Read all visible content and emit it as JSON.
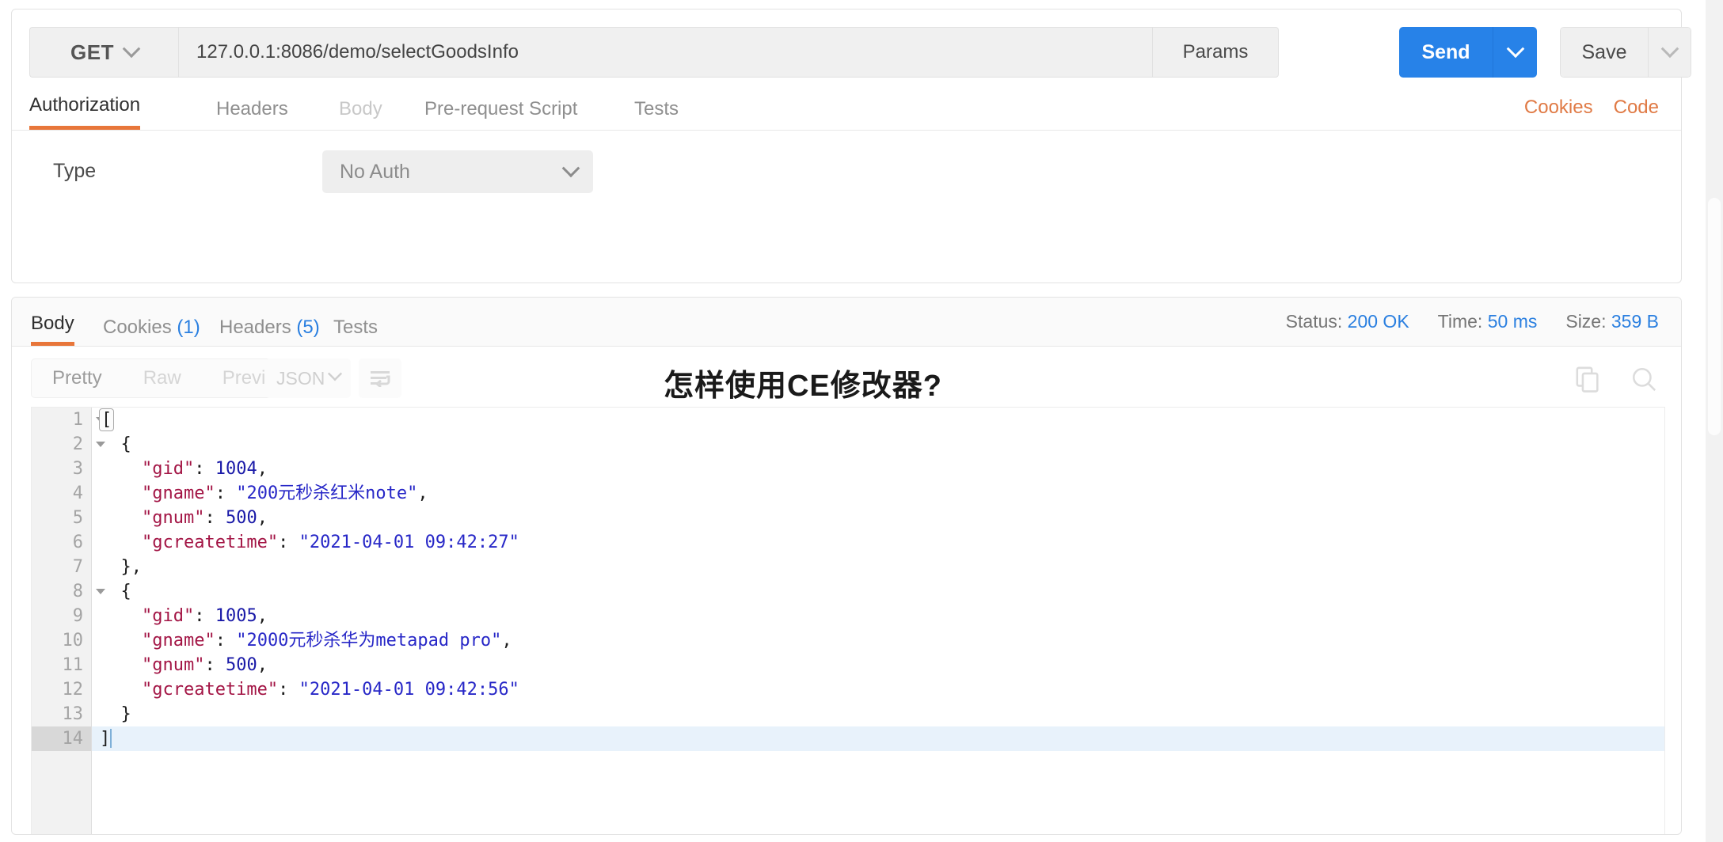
{
  "request": {
    "method": "GET",
    "url": "127.0.0.1:8086/demo/selectGoodsInfo",
    "params_label": "Params",
    "send_label": "Send",
    "save_label": "Save",
    "tabs": [
      {
        "label": "Authorization",
        "state": "active"
      },
      {
        "label": "Headers",
        "state": "normal"
      },
      {
        "label": "Body",
        "state": "dim"
      },
      {
        "label": "Pre-request Script",
        "state": "normal"
      },
      {
        "label": "Tests",
        "state": "normal"
      }
    ],
    "links": [
      {
        "label": "Cookies"
      },
      {
        "label": "Code"
      }
    ],
    "auth": {
      "type_label": "Type",
      "type_value": "No Auth"
    }
  },
  "response": {
    "tabs": [
      {
        "label": "Body",
        "count": "",
        "state": "active"
      },
      {
        "label": "Cookies",
        "count": "(1)",
        "state": "normal"
      },
      {
        "label": "Headers",
        "count": "(5)",
        "state": "normal"
      },
      {
        "label": "Tests",
        "count": "",
        "state": "normal"
      }
    ],
    "meta": {
      "status_label": "Status:",
      "status_value": "200 OK",
      "time_label": "Time:",
      "time_value": "50 ms",
      "size_label": "Size:",
      "size_value": "359 B"
    },
    "viewmodes": [
      {
        "label": "Pretty",
        "state": "on"
      },
      {
        "label": "Raw",
        "state": "off"
      },
      {
        "label": "Preview",
        "state": "off"
      }
    ],
    "format": "JSON",
    "overlay_title": "怎样使用CE修改器?",
    "code_lines": [
      {
        "no": "1",
        "fold": true,
        "current": false,
        "tokens": [
          {
            "t": "[",
            "c": "p match"
          }
        ]
      },
      {
        "no": "2",
        "fold": true,
        "current": false,
        "tokens": [
          {
            "t": "  {",
            "c": "p"
          }
        ]
      },
      {
        "no": "3",
        "fold": false,
        "current": false,
        "tokens": [
          {
            "t": "    \"gid\"",
            "c": "k"
          },
          {
            "t": ": ",
            "c": "p"
          },
          {
            "t": "1004",
            "c": "n"
          },
          {
            "t": ",",
            "c": "p"
          }
        ]
      },
      {
        "no": "4",
        "fold": false,
        "current": false,
        "tokens": [
          {
            "t": "    \"gname\"",
            "c": "k"
          },
          {
            "t": ": ",
            "c": "p"
          },
          {
            "t": "\"200元秒杀红米note\"",
            "c": "s"
          },
          {
            "t": ",",
            "c": "p"
          }
        ]
      },
      {
        "no": "5",
        "fold": false,
        "current": false,
        "tokens": [
          {
            "t": "    \"gnum\"",
            "c": "k"
          },
          {
            "t": ": ",
            "c": "p"
          },
          {
            "t": "500",
            "c": "n"
          },
          {
            "t": ",",
            "c": "p"
          }
        ]
      },
      {
        "no": "6",
        "fold": false,
        "current": false,
        "tokens": [
          {
            "t": "    \"gcreatetime\"",
            "c": "k"
          },
          {
            "t": ": ",
            "c": "p"
          },
          {
            "t": "\"2021-04-01 09:42:27\"",
            "c": "s"
          }
        ]
      },
      {
        "no": "7",
        "fold": false,
        "current": false,
        "tokens": [
          {
            "t": "  },",
            "c": "p"
          }
        ]
      },
      {
        "no": "8",
        "fold": true,
        "current": false,
        "tokens": [
          {
            "t": "  {",
            "c": "p"
          }
        ]
      },
      {
        "no": "9",
        "fold": false,
        "current": false,
        "tokens": [
          {
            "t": "    \"gid\"",
            "c": "k"
          },
          {
            "t": ": ",
            "c": "p"
          },
          {
            "t": "1005",
            "c": "n"
          },
          {
            "t": ",",
            "c": "p"
          }
        ]
      },
      {
        "no": "10",
        "fold": false,
        "current": false,
        "tokens": [
          {
            "t": "    \"gname\"",
            "c": "k"
          },
          {
            "t": ": ",
            "c": "p"
          },
          {
            "t": "\"2000元秒杀华为metapad pro\"",
            "c": "s"
          },
          {
            "t": ",",
            "c": "p"
          }
        ]
      },
      {
        "no": "11",
        "fold": false,
        "current": false,
        "tokens": [
          {
            "t": "    \"gnum\"",
            "c": "k"
          },
          {
            "t": ": ",
            "c": "p"
          },
          {
            "t": "500",
            "c": "n"
          },
          {
            "t": ",",
            "c": "p"
          }
        ]
      },
      {
        "no": "12",
        "fold": false,
        "current": false,
        "tokens": [
          {
            "t": "    \"gcreatetime\"",
            "c": "k"
          },
          {
            "t": ": ",
            "c": "p"
          },
          {
            "t": "\"2021-04-01 09:42:56\"",
            "c": "s"
          }
        ]
      },
      {
        "no": "13",
        "fold": false,
        "current": false,
        "tokens": [
          {
            "t": "  }",
            "c": "p"
          }
        ]
      },
      {
        "no": "14",
        "fold": false,
        "current": true,
        "tokens": [
          {
            "t": "]",
            "c": "p"
          }
        ]
      }
    ]
  },
  "colors": {
    "accent_orange": "#e8763a",
    "send_blue": "#2782e8",
    "link_blue": "#2a7fe0",
    "link_orange": "#e07a45"
  }
}
